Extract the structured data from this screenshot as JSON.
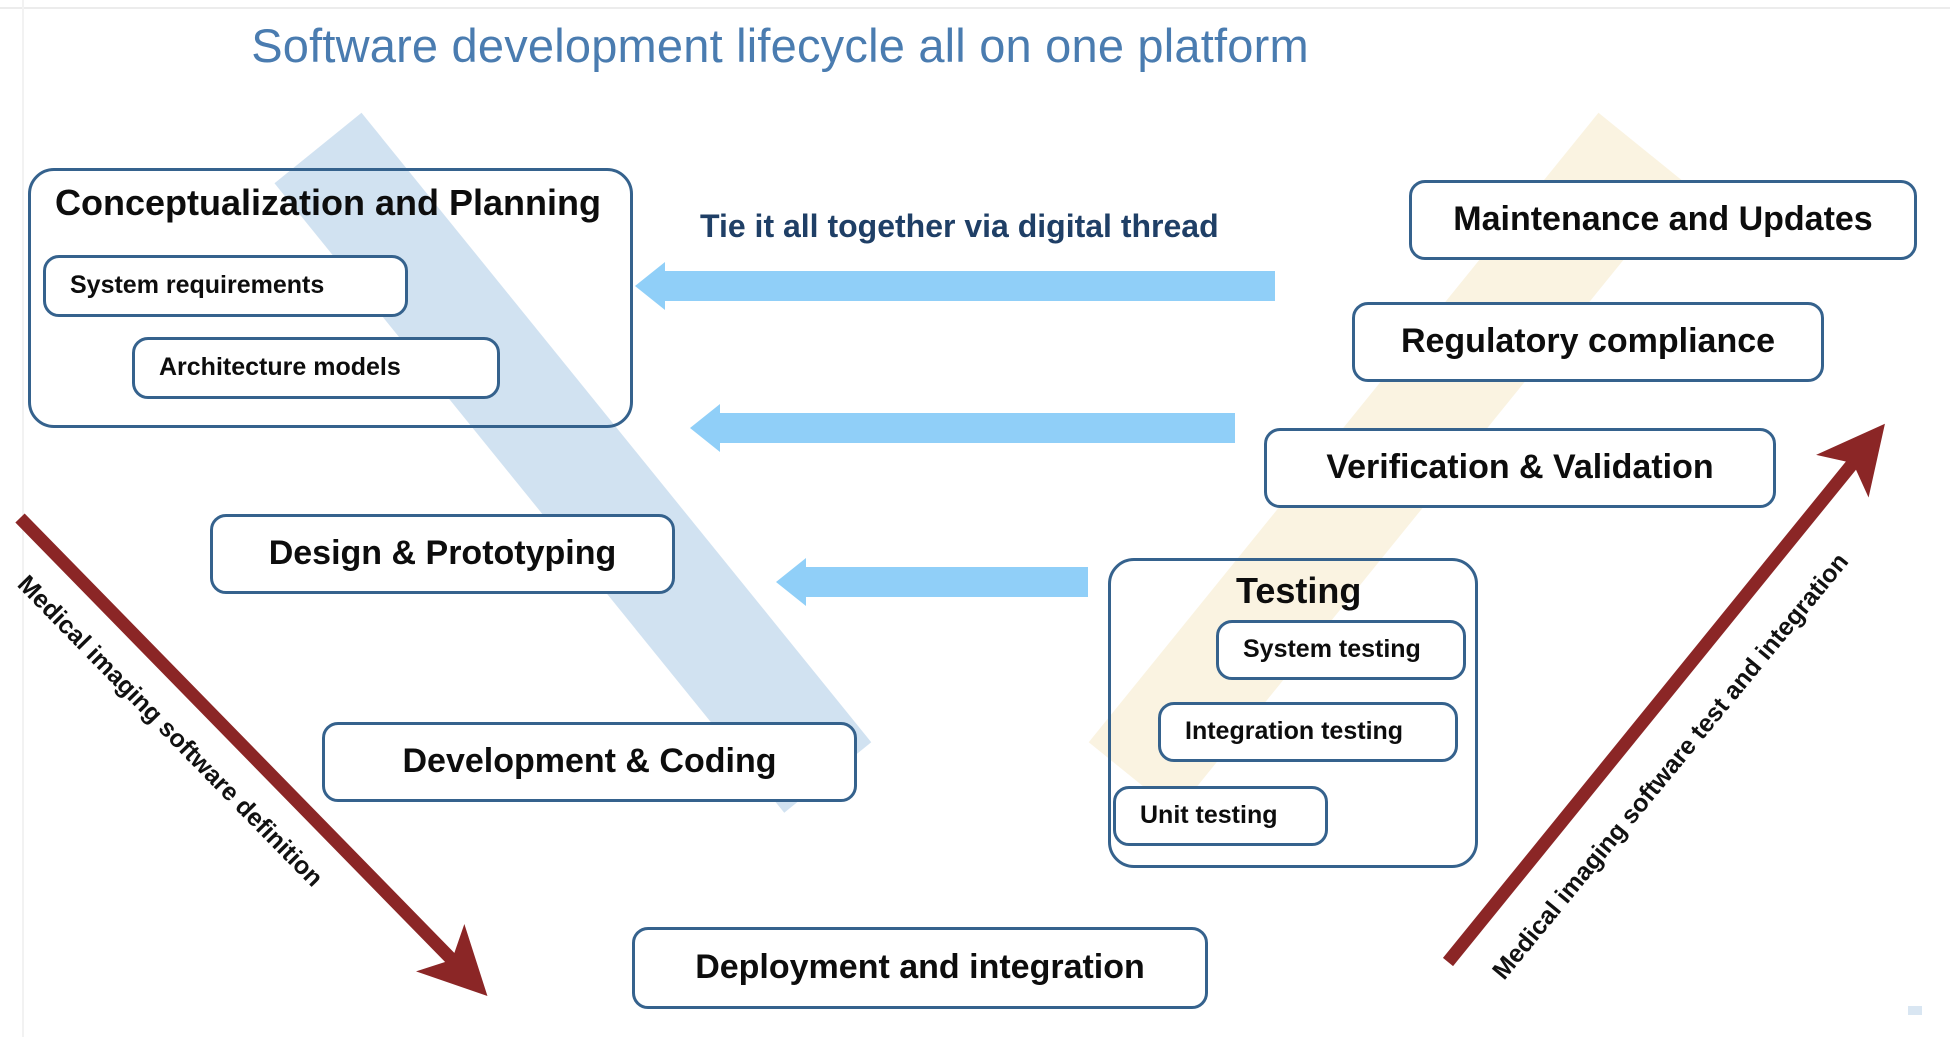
{
  "slide": {
    "title": "Software development lifecycle all on one platform",
    "title_color": "#4a7cb0",
    "background_color": "#ffffff"
  },
  "theme": {
    "box_border_color": "#35628d",
    "box_fill_color": "#ffffff",
    "box_text_color": "#0d0d0d",
    "arrow_blue": "#90cff8",
    "diagonal_arrow_red": "#8b2626",
    "band_blue": "#cddff0",
    "band_cream": "#faf2df",
    "thread_label_color": "#1f3f66"
  },
  "left_branch": {
    "axis_label": "Medical imaging software definition",
    "groups": [
      {
        "name": "conceptualization-and-planning",
        "title": "Conceptualization and Planning",
        "items": [
          {
            "label": "System requirements"
          },
          {
            "label": "Architecture models"
          }
        ]
      }
    ],
    "stages": [
      {
        "label": "Design & Prototyping"
      },
      {
        "label": "Development & Coding"
      }
    ]
  },
  "bottom": {
    "label": "Deployment and integration"
  },
  "right_branch": {
    "axis_label": "Medical imaging software test and integration",
    "stages": [
      {
        "label": "Maintenance and Updates"
      },
      {
        "label": "Regulatory compliance"
      },
      {
        "label": "Verification & Validation"
      }
    ],
    "groups": [
      {
        "name": "testing",
        "title": "Testing",
        "items": [
          {
            "label": "System testing"
          },
          {
            "label": "Integration testing"
          },
          {
            "label": "Unit testing"
          }
        ]
      }
    ]
  },
  "digital_thread": {
    "label": "Tie it all together via digital thread",
    "arrows": [
      {
        "name": "thread-arrow-top"
      },
      {
        "name": "thread-arrow-middle"
      },
      {
        "name": "thread-arrow-bottom"
      }
    ]
  }
}
